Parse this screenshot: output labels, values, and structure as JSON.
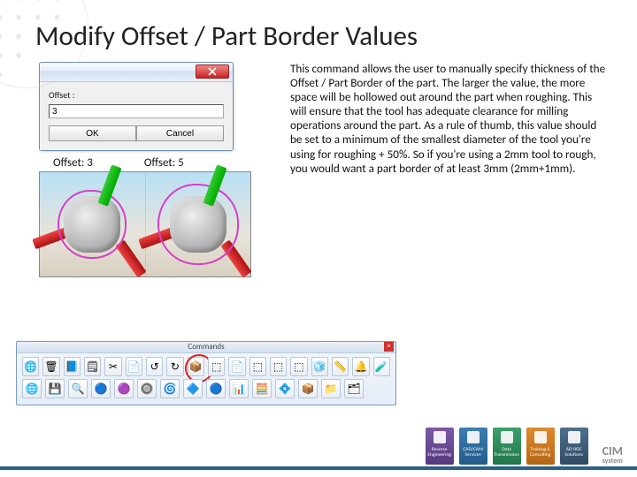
{
  "title": "Modify Offset / Part Border Values",
  "dialog": {
    "label": "Offset :",
    "value": "3",
    "ok": "OK",
    "cancel": "Cancel"
  },
  "offset_labels": {
    "a": "Offset: 3",
    "b": "Offset: 5"
  },
  "description": "This command allows the user to manually specify thickness of the Offset / Part Border of the part. The larger the value, the more space will be hollowed out around the part when roughing. This will ensure that the tool has adequate clearance for milling operations around the part. As a rule of thumb, this value should be set to a minimum of the smallest diameter of the tool you're using for roughing + 50%. So if you're using a 2mm tool to rough, you would want a part border of at least 3mm (2mm+1mm).",
  "commands": {
    "title": "Commands",
    "row1": [
      "🌐",
      "🗑",
      "📘",
      "🗒",
      "✂",
      "📄",
      "↺",
      "↻",
      "📦",
      "⬚",
      "📄",
      "⬚",
      "⬚",
      "⬚",
      "🧊",
      "📏",
      "🔔",
      "🧪"
    ],
    "row2": [
      "🌐",
      "💾",
      "🔍",
      "🔵",
      "🟣",
      "🔘",
      "🌀",
      "🔷",
      "🔵",
      "📊",
      "🧮",
      "💠",
      "📦",
      "📁",
      "🗂"
    ]
  },
  "footer": {
    "boxes": [
      "Reverse Engineering",
      "CAD/CAM Services",
      "Data Transmission",
      "Training & Consulting",
      "AD HOC Solutions"
    ],
    "brand": "CIM",
    "brand_sub": "system"
  }
}
